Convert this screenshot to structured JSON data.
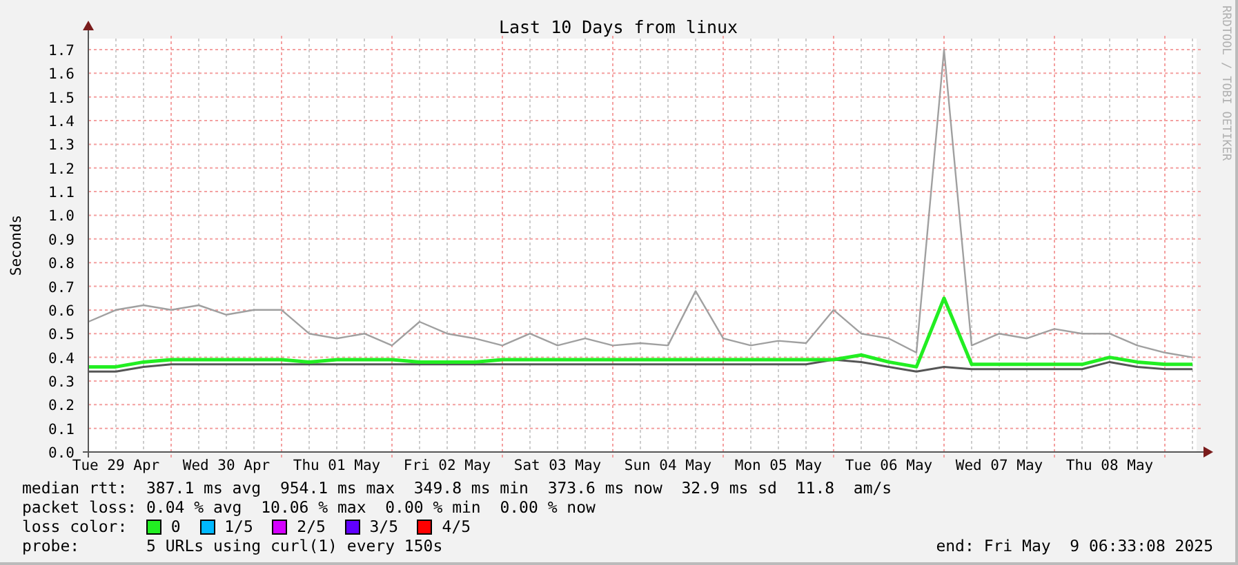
{
  "chart": {
    "chart_data": {
      "type": "line",
      "title": "Last 10 Days from linux",
      "ylabel": "Seconds",
      "ylim": [
        0,
        1.7
      ],
      "grid": true,
      "categories": [
        null,
        "Tue 29 Apr",
        null,
        null,
        null,
        "Wed 30 Apr",
        null,
        null,
        null,
        "Thu 01 May",
        null,
        null,
        null,
        "Fri 02 May",
        null,
        null,
        null,
        "Sat 03 May",
        null,
        null,
        null,
        "Sun 04 May",
        null,
        null,
        null,
        "Mon 05 May",
        null,
        null,
        null,
        "Tue 06 May",
        null,
        null,
        null,
        "Wed 07 May",
        null,
        null,
        null,
        "Thu 08 May",
        null,
        null,
        null
      ],
      "yticks": [
        {
          "value": 0,
          "label": "0.0"
        },
        {
          "value": 0.1,
          "label": "0.1"
        },
        {
          "value": 0.2,
          "label": "0.2"
        },
        {
          "value": 0.3,
          "label": "0.3"
        },
        {
          "value": 0.4,
          "label": "0.4"
        },
        {
          "value": 0.5,
          "label": "0.5"
        },
        {
          "value": 0.6,
          "label": "0.6"
        },
        {
          "value": 0.7,
          "label": "0.7"
        },
        {
          "value": 0.8,
          "label": "0.8"
        },
        {
          "value": 0.9,
          "label": "0.9"
        },
        {
          "value": 1.0,
          "label": "1.0"
        },
        {
          "value": 1.1,
          "label": "1.1"
        },
        {
          "value": 1.2,
          "label": "1.2"
        },
        {
          "value": 1.3,
          "label": "1.3"
        },
        {
          "value": 1.4,
          "label": "1.4"
        },
        {
          "value": 1.5,
          "label": "1.5"
        },
        {
          "value": 1.6,
          "label": "1.6"
        },
        {
          "value": 1.7,
          "label": "1.7"
        }
      ],
      "series": [
        {
          "color": "#a0a0a0",
          "values": [
            0.55,
            0.6,
            0.62,
            0.6,
            0.62,
            0.58,
            0.6,
            0.6,
            0.5,
            0.48,
            0.5,
            0.45,
            0.55,
            0.5,
            0.48,
            0.45,
            0.5,
            0.45,
            0.48,
            0.45,
            0.46,
            0.45,
            0.68,
            0.48,
            0.45,
            0.47,
            0.46,
            0.6,
            0.5,
            0.48,
            0.42,
            1.7,
            0.45,
            0.5,
            0.48,
            0.52,
            0.5,
            0.5,
            0.45,
            0.42,
            0.4
          ]
        },
        {
          "color": "#555555",
          "values": [
            0.34,
            0.34,
            0.36,
            0.37,
            0.37,
            0.37,
            0.37,
            0.37,
            0.37,
            0.37,
            0.37,
            0.37,
            0.37,
            0.37,
            0.37,
            0.37,
            0.37,
            0.37,
            0.37,
            0.37,
            0.37,
            0.37,
            0.37,
            0.37,
            0.37,
            0.37,
            0.37,
            0.39,
            0.38,
            0.36,
            0.34,
            0.36,
            0.35,
            0.35,
            0.35,
            0.35,
            0.35,
            0.38,
            0.36,
            0.35,
            0.35
          ]
        },
        {
          "color": "#22ee22",
          "values": [
            0.36,
            0.36,
            0.38,
            0.39,
            0.39,
            0.39,
            0.39,
            0.39,
            0.38,
            0.39,
            0.39,
            0.39,
            0.38,
            0.38,
            0.38,
            0.39,
            0.39,
            0.39,
            0.39,
            0.39,
            0.39,
            0.39,
            0.39,
            0.39,
            0.39,
            0.39,
            0.39,
            0.39,
            0.41,
            0.38,
            0.36,
            0.65,
            0.37,
            0.37,
            0.37,
            0.37,
            0.37,
            0.4,
            0.38,
            0.37,
            0.37
          ]
        }
      ]
    },
    "credit": "RRDTOOL / TOBI OETIKER"
  },
  "legend": [
    {
      "kind": "values",
      "label": "median rtt:",
      "items": [
        "387.1 ms avg",
        "954.1 ms max",
        "349.8 ms min",
        "373.6 ms now",
        "32.9 ms sd",
        "11.8",
        "am/s"
      ]
    },
    {
      "kind": "values",
      "label": "packet loss:",
      "items": [
        "0.04 % avg",
        "10.06 % max",
        "0.00 % min",
        "0.00 % now"
      ]
    },
    {
      "kind": "colors",
      "label": "loss color:",
      "swatches": [
        {
          "label": "0",
          "color": "#22ee22"
        },
        {
          "label": "1/5",
          "color": "#00b8ff"
        },
        {
          "label": "2/5",
          "color": "#d400ff"
        },
        {
          "label": "3/5",
          "color": "#6000ff"
        },
        {
          "label": "4/5",
          "color": "#ff0000"
        }
      ]
    },
    {
      "kind": "probe",
      "label": "probe:",
      "text": "5 URLs using curl(1) every 150s",
      "end": "end: Fri May  9 06:33:08 2025"
    }
  ]
}
